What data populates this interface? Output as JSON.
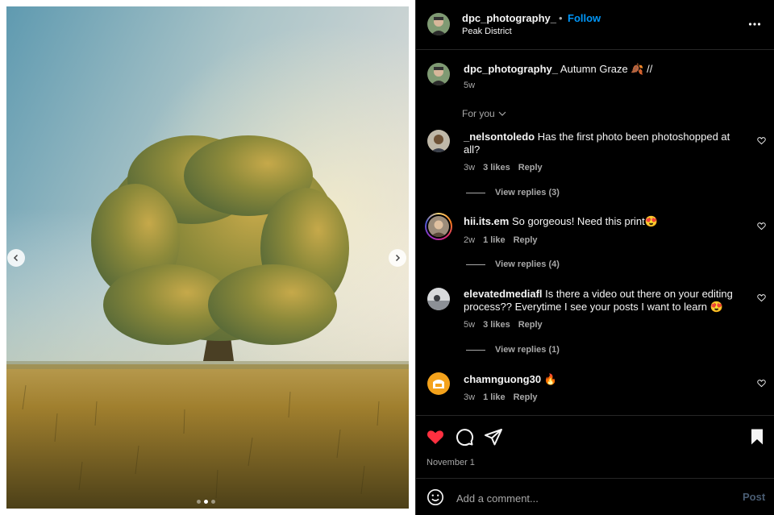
{
  "post": {
    "username": "dpc_photography_",
    "follow_label": "Follow",
    "separator": "•",
    "location": "Peak District",
    "caption": "Autumn Graze 🍂 //",
    "caption_time": "5w",
    "filter_label": "For you",
    "date": "November 1",
    "carousel": {
      "count": 3,
      "active_index": 1
    }
  },
  "comments": [
    {
      "username": "_nelsontoledo",
      "text": "Has the first photo been photoshopped at all?",
      "time": "3w",
      "likes": "3 likes",
      "reply": "Reply",
      "view_replies": "View replies (3)"
    },
    {
      "username": "hii.its.em",
      "text": "So gorgeous! Need this print😍",
      "time": "2w",
      "likes": "1 like",
      "reply": "Reply",
      "view_replies": "View replies (4)"
    },
    {
      "username": "elevatedmediafl",
      "text": "Is there a video out there on your editing process?? Everytime I see your posts I want to learn 😍",
      "time": "5w",
      "likes": "3 likes",
      "reply": "Reply",
      "view_replies": "View replies (1)"
    },
    {
      "username": "chamnguong30",
      "text": "🔥",
      "time": "3w",
      "likes": "1 like",
      "reply": "Reply"
    }
  ],
  "add_comment": {
    "placeholder": "Add a comment...",
    "post_label": "Post"
  },
  "colors": {
    "follow": "#0095f6",
    "like": "#ff3040",
    "background": "#000000",
    "muted": "#a8a8a8"
  },
  "icons": [
    "chevron-left-icon",
    "chevron-right-icon",
    "more-icon",
    "heart-icon",
    "comment-icon",
    "share-icon",
    "bookmark-icon",
    "emoji-icon",
    "chevron-down-icon"
  ]
}
